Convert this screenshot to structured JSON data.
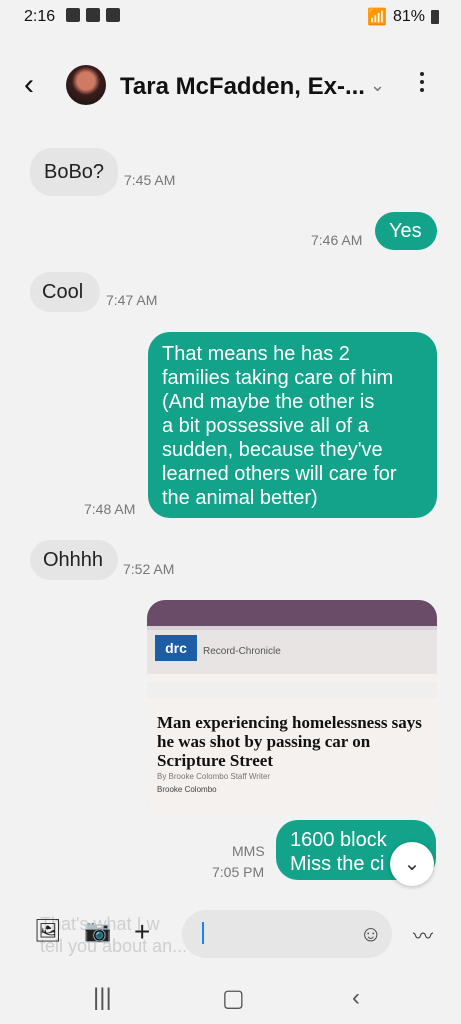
{
  "status": {
    "time": "2:16",
    "battery": "81%"
  },
  "header": {
    "title": "Tara McFadden, Ex-..."
  },
  "messages": [
    {
      "text": "BoBo?",
      "time": "7:45 AM",
      "side": "in"
    },
    {
      "text": "Yes",
      "time": "7:46 AM",
      "side": "out"
    },
    {
      "text": "Cool",
      "time": "7:47 AM",
      "side": "in"
    },
    {
      "lines": [
        "That means he has 2",
        "families taking care of him",
        "(And maybe the other is",
        "a bit possessive all of a",
        "sudden, because they've",
        "learned others will care for",
        "the animal better)"
      ],
      "time": "7:48 AM",
      "side": "out"
    },
    {
      "text": "Ohhhh",
      "time": "7:52 AM",
      "side": "in"
    }
  ],
  "media": {
    "logo": "drc",
    "paper_name": "Record-Chronicle",
    "headline": "Man experiencing homelessness says he was shot by passing car on Scripture Street",
    "byline": "By Brooke Colombo Staff Writer",
    "byline2": "Brooke Colombo"
  },
  "last": {
    "label": "MMS",
    "time": "7:05 PM",
    "lines": [
      "1600 block",
      "Miss the ci"
    ]
  },
  "composer": {
    "ghost_lines": [
      "That's what I w",
      "tell you about an..."
    ]
  },
  "icons": [
    "gallery-icon",
    "camera-icon",
    "plus-icon",
    "emoji-icon",
    "voice-icon",
    "back-icon",
    "scroll-down-icon"
  ]
}
